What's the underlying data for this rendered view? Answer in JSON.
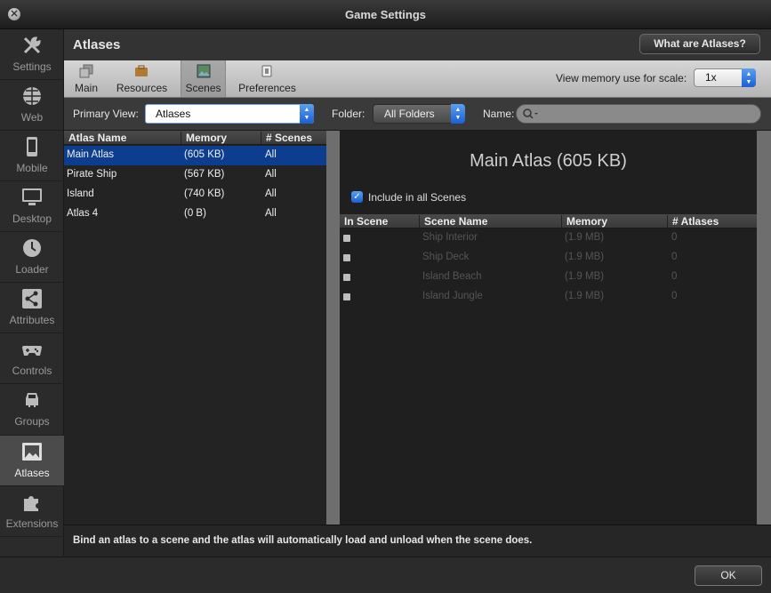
{
  "window": {
    "title": "Game Settings"
  },
  "sidebar": {
    "items": [
      {
        "label": "Settings",
        "icon": "wrench-screwdriver-icon"
      },
      {
        "label": "Web",
        "icon": "globe-icon"
      },
      {
        "label": "Mobile",
        "icon": "phone-icon"
      },
      {
        "label": "Desktop",
        "icon": "monitor-icon"
      },
      {
        "label": "Loader",
        "icon": "clock-icon"
      },
      {
        "label": "Attributes",
        "icon": "share-icon"
      },
      {
        "label": "Controls",
        "icon": "gamepad-icon"
      },
      {
        "label": "Groups",
        "icon": "car-icon"
      },
      {
        "label": "Atlases",
        "icon": "picture-icon",
        "active": true
      },
      {
        "label": "Extensions",
        "icon": "puzzle-icon"
      }
    ]
  },
  "header": {
    "title": "Atlases",
    "help_button": "What are Atlases?"
  },
  "toolbar": {
    "tabs": [
      {
        "label": "Main",
        "icon": "copy-icon"
      },
      {
        "label": "Resources",
        "icon": "briefcase-icon"
      },
      {
        "label": "Scenes",
        "icon": "image-icon",
        "active": true
      },
      {
        "label": "Preferences",
        "icon": "switch-icon"
      }
    ],
    "memory_label": "View memory use for scale:",
    "scale_value": "1x"
  },
  "filters": {
    "primary_view_label": "Primary View:",
    "primary_view_value": "Atlases",
    "folder_label": "Folder:",
    "folder_value": "All Folders",
    "name_label": "Name:"
  },
  "atlas_table": {
    "columns": [
      "Atlas Name",
      "Memory",
      "# Scenes"
    ],
    "rows": [
      {
        "name": "Main Atlas",
        "memory": "(605 KB)",
        "scenes": "All",
        "selected": true
      },
      {
        "name": "Pirate Ship",
        "memory": "(567 KB)",
        "scenes": "All"
      },
      {
        "name": "Island",
        "memory": "(740 KB)",
        "scenes": "All"
      },
      {
        "name": "Atlas 4",
        "memory": "(0 B)",
        "scenes": "All"
      }
    ]
  },
  "detail": {
    "title": "Main Atlas (605 KB)",
    "include_all_label": "Include in all Scenes",
    "include_all_checked": true,
    "scene_columns": [
      "In Scene",
      "Scene Name",
      "Memory",
      "# Atlases"
    ],
    "scene_rows": [
      {
        "name": "Ship Interior",
        "memory": "(1.9 MB)",
        "atlases": "0"
      },
      {
        "name": "Ship Deck",
        "memory": "(1.9 MB)",
        "atlases": "0"
      },
      {
        "name": "Island Beach",
        "memory": "(1.9 MB)",
        "atlases": "0"
      },
      {
        "name": "Island Jungle",
        "memory": "(1.9 MB)",
        "atlases": "0"
      }
    ]
  },
  "info": {
    "text": "Bind an atlas to a scene and the atlas will automatically load and unload when the scene does."
  },
  "footer": {
    "ok_label": "OK"
  },
  "colors": {
    "selection": "#0d3d8f",
    "accent_blue": "#1b5fd6"
  }
}
